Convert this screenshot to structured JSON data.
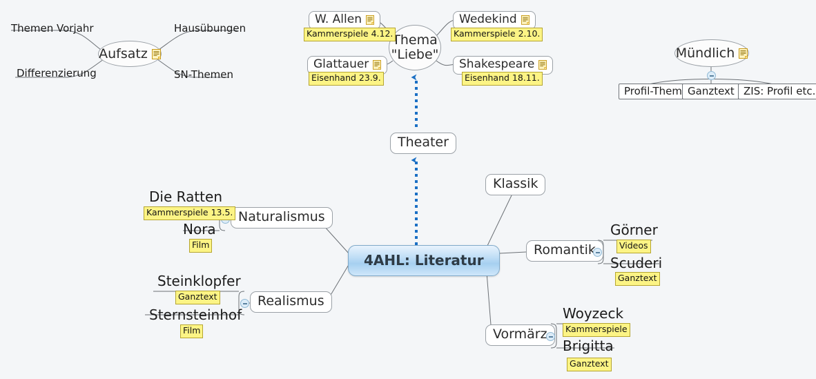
{
  "canvas": {
    "background_color": "#f4f6f8",
    "root_accent_color": "#a6d0f0",
    "tag_color": "#fcf485",
    "link_arrow_color": "#1a6fc4"
  },
  "root": {
    "label": "4AHL: Literatur"
  },
  "floating_topics": {
    "aufsatz": {
      "label": "Aufsatz",
      "note_icon": "note-icon",
      "branches": [
        {
          "label": "Themen Vorjahr"
        },
        {
          "label": "Hausübungen"
        },
        {
          "label": "Differenzierung"
        },
        {
          "label": "SN-Themen"
        }
      ]
    },
    "muendlich": {
      "label": "Mündlich",
      "note_icon": "note-icon",
      "toggle": "collapse-toggle",
      "children": [
        {
          "label": "Profil-Thema",
          "note_icon": null
        },
        {
          "label": "Ganztext",
          "note_icon": "note-icon"
        },
        {
          "label": "ZIS: Profil etc.",
          "note_icon": null
        }
      ]
    },
    "thema_liebe": {
      "label_line1": "Thema",
      "label_line2": "\"Liebe\"",
      "children": [
        {
          "label": "W. Allen",
          "note_icon": "note-icon",
          "tag": "Kammerspiele 4.12."
        },
        {
          "label": "Glattauer",
          "note_icon": "note-icon",
          "tag": "Eisenhand 23.9."
        },
        {
          "label": "Wedekind",
          "note_icon": "note-icon",
          "tag": "Kammerspiele 2.10."
        },
        {
          "label": "Shakespeare",
          "note_icon": "note-icon",
          "tag": "Eisenhand 18.11."
        }
      ]
    }
  },
  "theater": {
    "label": "Theater"
  },
  "main_branches": [
    {
      "label": "Naturalismus",
      "toggle": "collapse-toggle",
      "children": [
        {
          "label": "Die Ratten",
          "tag": "Kammerspiele 13.5."
        },
        {
          "label": "Nora",
          "tag": "Film"
        }
      ]
    },
    {
      "label": "Realismus",
      "toggle": "collapse-toggle",
      "children": [
        {
          "label": "Steinklopfer",
          "tag": "Ganztext"
        },
        {
          "label": "Sternsteinhof",
          "tag": "Film"
        }
      ]
    },
    {
      "label": "Klassik",
      "toggle": null,
      "children": []
    },
    {
      "label": "Romantik",
      "toggle": "collapse-toggle",
      "children": [
        {
          "label": "Görner",
          "tag": "Videos"
        },
        {
          "label": "Scuderi",
          "tag": "Ganztext"
        }
      ]
    },
    {
      "label": "Vormärz",
      "toggle": "collapse-toggle",
      "children": [
        {
          "label": "Woyzeck",
          "tag": "Kammerspiele"
        },
        {
          "label": "Brigitta",
          "tag": "Ganztext"
        }
      ]
    }
  ]
}
